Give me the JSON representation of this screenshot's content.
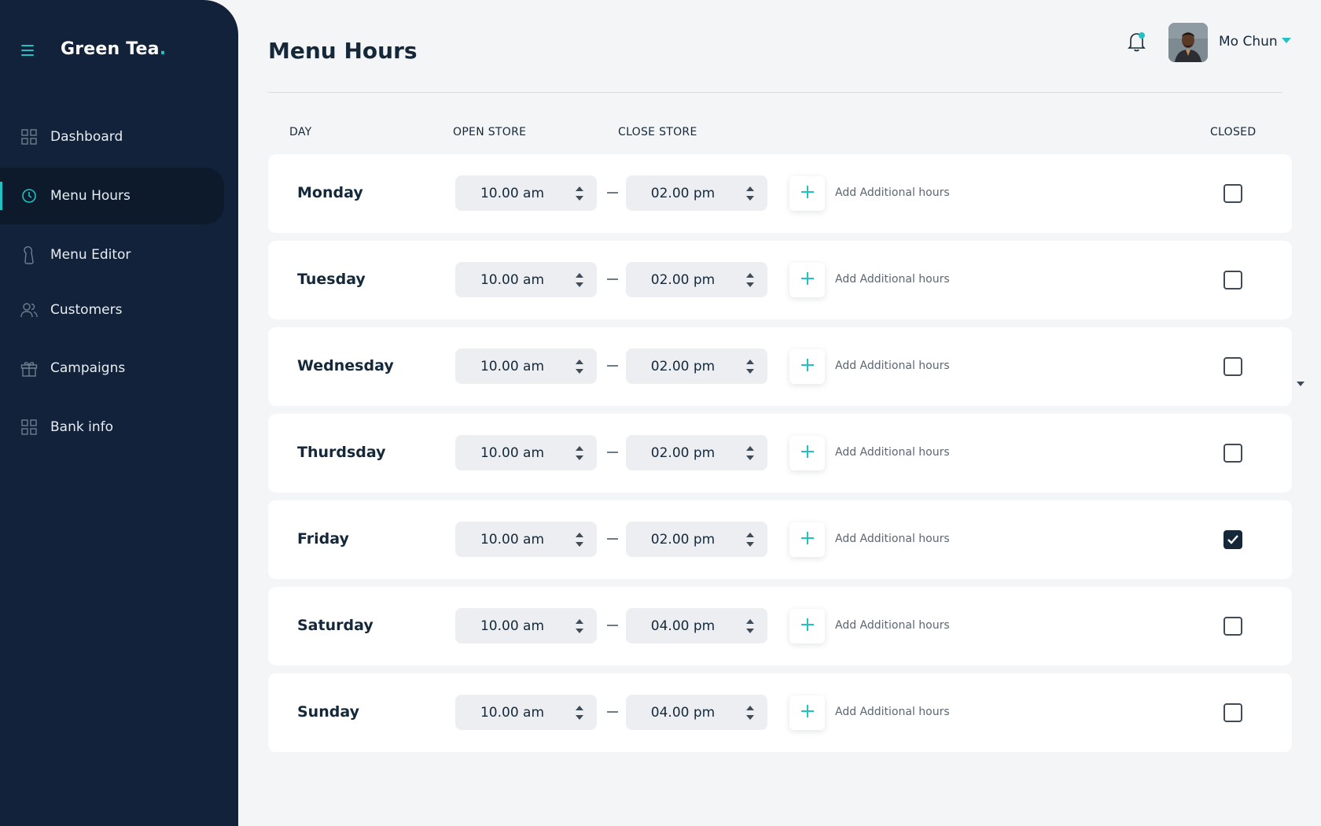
{
  "app": {
    "brand_name": "Green Tea",
    "brand_dot": ".",
    "accent_color": "#22c1c3",
    "sidebar_color": "#12223a"
  },
  "sidebar": {
    "items": [
      {
        "label": "Dashboard",
        "icon": "grid-icon",
        "active": false
      },
      {
        "label": "Menu Hours",
        "icon": "clock-icon",
        "active": true
      },
      {
        "label": "Menu Editor",
        "icon": "cup-icon",
        "active": false
      },
      {
        "label": "Customers",
        "icon": "users-icon",
        "active": false
      },
      {
        "label": "Campaigns",
        "icon": "gift-icon",
        "active": false
      },
      {
        "label": "Bank info",
        "icon": "grid-icon",
        "active": false
      }
    ]
  },
  "header": {
    "title": "Menu Hours",
    "user_name": "Mo Chun",
    "notification_icon": "bell-icon",
    "has_notification": true
  },
  "table": {
    "columns": {
      "day": "DAY",
      "open": "OPEN STORE",
      "close": "CLOSE STORE",
      "closed": "CLOSED"
    },
    "add_label": "Add Additional hours",
    "rows": [
      {
        "day": "Monday",
        "open": "10.00 am",
        "close": "02.00 pm",
        "closed": false
      },
      {
        "day": "Tuesday",
        "open": "10.00 am",
        "close": "02.00 pm",
        "closed": false
      },
      {
        "day": "Wednesday",
        "open": "10.00 am",
        "close": "02.00 pm",
        "closed": false
      },
      {
        "day": "Thurdsday",
        "open": "10.00 am",
        "close": "02.00 pm",
        "closed": false
      },
      {
        "day": "Friday",
        "open": "10.00 am",
        "close": "02.00 pm",
        "closed": true
      },
      {
        "day": "Saturday",
        "open": "10.00 am",
        "close": "04.00 pm",
        "closed": false
      },
      {
        "day": "Sunday",
        "open": "10.00 am",
        "close": "04.00 pm",
        "closed": false
      }
    ]
  }
}
